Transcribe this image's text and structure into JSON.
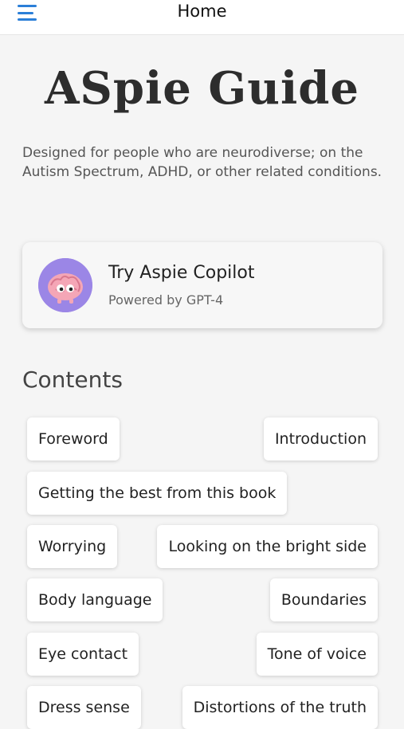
{
  "header": {
    "title": "Home",
    "menu_icon": "hamburger-menu-icon"
  },
  "app": {
    "title": "ASpie Guide",
    "tagline": "Designed for people who are neurodiverse; on the Autism Spectrum, ADHD, or other related conditions."
  },
  "copilot": {
    "title": "Try Aspie Copilot",
    "subtitle": "Powered by GPT-4",
    "avatar_icon": "brain-icon",
    "avatar_bg": "#9b86e6"
  },
  "contents": {
    "heading": "Contents",
    "rows": [
      [
        "Foreword",
        "Introduction"
      ],
      [
        "Getting the best from this book"
      ],
      [
        "Worrying",
        "Looking on the bright side"
      ],
      [
        "Body language",
        "Boundaries"
      ],
      [
        "Eye contact",
        "Tone of voice"
      ],
      [
        "Dress sense",
        "Distortions of the truth"
      ]
    ]
  },
  "colors": {
    "accent": "#2b7fd8",
    "background": "#f5f5f5"
  }
}
